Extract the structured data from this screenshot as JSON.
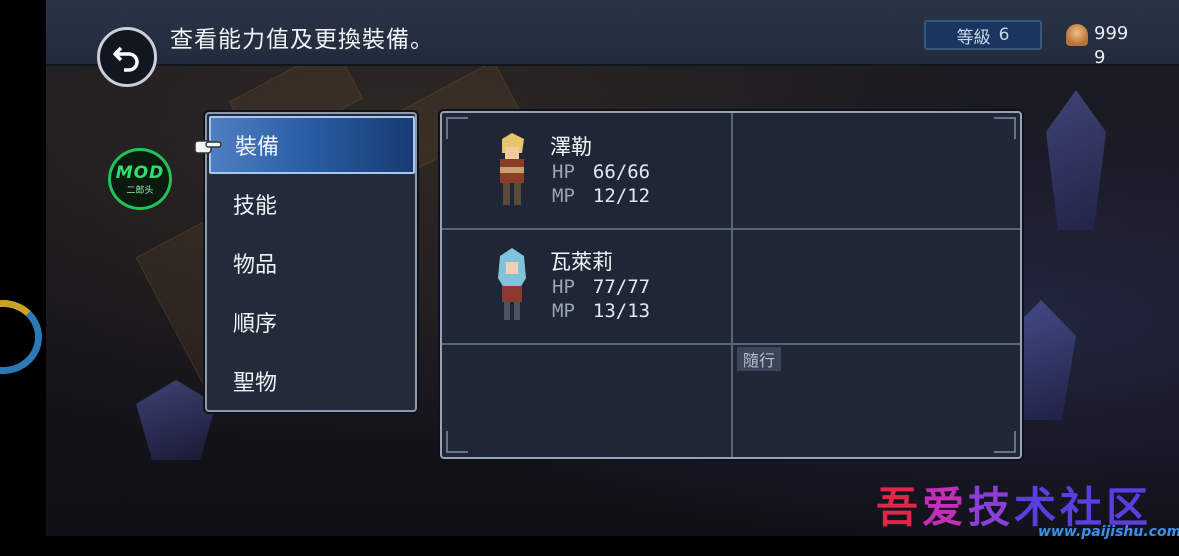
{
  "header": {
    "back_icon": "back-arrow-icon",
    "hint": "查看能力值及更換裝備。",
    "level_label": "等級",
    "level_value": "6",
    "gold_icon": "gold-coin-icon",
    "gold_value": "9999"
  },
  "mod_badge": {
    "line1": "MOD",
    "line2": "二郎头"
  },
  "menu": {
    "selected_index": 0,
    "items": [
      "裝備",
      "技能",
      "物品",
      "順序",
      "聖物"
    ]
  },
  "party": {
    "members": [
      {
        "name": "澤勒",
        "hp_label": "HP",
        "hp": "66/66",
        "mp_label": "MP",
        "mp": "12/12",
        "sprite": "blonde-warrior"
      },
      {
        "name": "瓦萊莉",
        "hp_label": "HP",
        "hp": "77/77",
        "mp_label": "MP",
        "mp": "13/13",
        "sprite": "blue-haired-monk"
      }
    ],
    "follower_tag": "隨行"
  },
  "watermark": {
    "text": "吾爱技术社区",
    "url": "www.paijishu.com"
  },
  "colors": {
    "menu_selected": "#2b5fa6",
    "panel_bg": "#1f2736",
    "level_box": "#1a3660",
    "mod_green": "#22c35a"
  }
}
